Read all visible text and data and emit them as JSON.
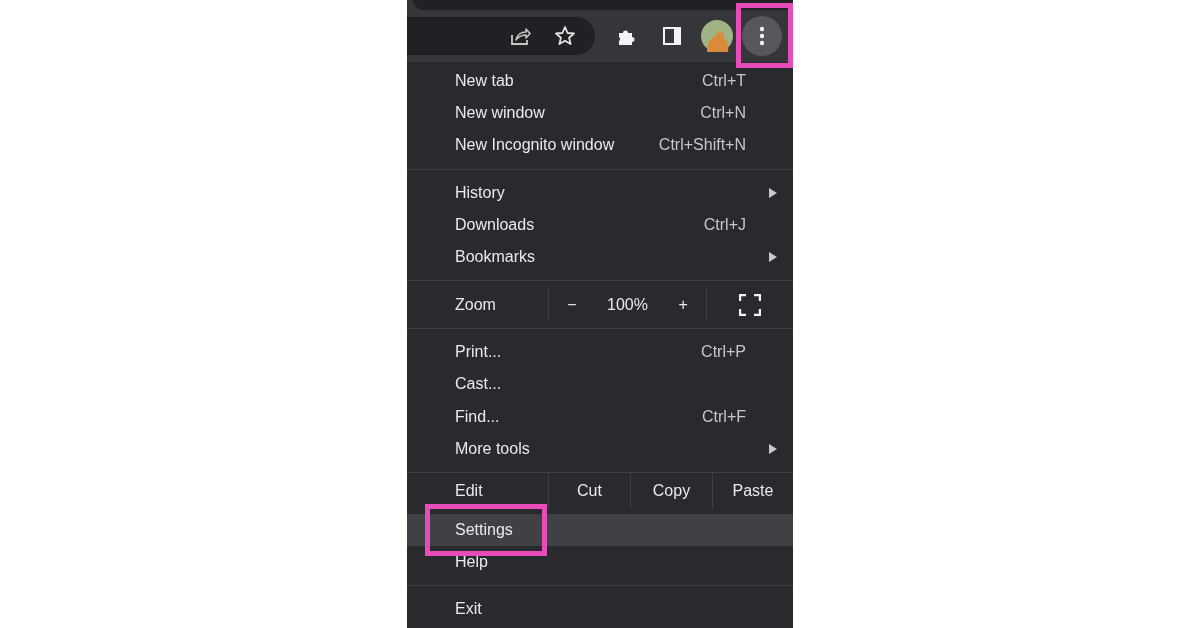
{
  "toolbar": {
    "buttons": [
      {
        "kind": "share"
      },
      {
        "kind": "star"
      }
    ],
    "actions": [
      {
        "kind": "extensions"
      },
      {
        "kind": "sidepanel"
      },
      {
        "kind": "avatar"
      },
      {
        "kind": "menu",
        "annotated": true
      }
    ]
  },
  "menu": [
    {
      "kind": "item",
      "label": "New tab",
      "shortcut": "Ctrl+T",
      "submenu": false,
      "selected": false,
      "annotated": false
    },
    {
      "kind": "item",
      "label": "New window",
      "shortcut": "Ctrl+N",
      "submenu": false,
      "selected": false,
      "annotated": false
    },
    {
      "kind": "item",
      "label": "New Incognito window",
      "shortcut": "Ctrl+Shift+N",
      "submenu": false,
      "selected": false,
      "annotated": false
    },
    {
      "kind": "separator"
    },
    {
      "kind": "item",
      "label": "History",
      "submenu": true,
      "selected": false,
      "annotated": false
    },
    {
      "kind": "item",
      "label": "Downloads",
      "shortcut": "Ctrl+J",
      "submenu": false,
      "selected": false,
      "annotated": false
    },
    {
      "kind": "item",
      "label": "Bookmarks",
      "submenu": true,
      "selected": false,
      "annotated": false
    },
    {
      "kind": "separator"
    },
    {
      "kind": "zoom",
      "label": "Zoom",
      "minus": "−",
      "value": "100%",
      "plus": "+"
    },
    {
      "kind": "separator"
    },
    {
      "kind": "item",
      "label": "Print...",
      "shortcut": "Ctrl+P",
      "submenu": false,
      "selected": false,
      "annotated": false
    },
    {
      "kind": "item",
      "label": "Cast...",
      "submenu": false,
      "selected": false,
      "annotated": false
    },
    {
      "kind": "item",
      "label": "Find...",
      "shortcut": "Ctrl+F",
      "submenu": false,
      "selected": false,
      "annotated": false
    },
    {
      "kind": "item",
      "label": "More tools",
      "submenu": true,
      "selected": false,
      "annotated": false
    },
    {
      "kind": "separator"
    },
    {
      "kind": "edit",
      "label": "Edit",
      "actions": [
        "Cut",
        "Copy",
        "Paste"
      ]
    },
    {
      "kind": "item",
      "label": "Settings",
      "submenu": false,
      "selected": true,
      "annotated": true
    },
    {
      "kind": "item",
      "label": "Help",
      "submenu": false,
      "selected": false,
      "annotated": false
    },
    {
      "kind": "separator"
    },
    {
      "kind": "item",
      "label": "Exit",
      "submenu": false,
      "selected": false,
      "annotated": false
    }
  ]
}
